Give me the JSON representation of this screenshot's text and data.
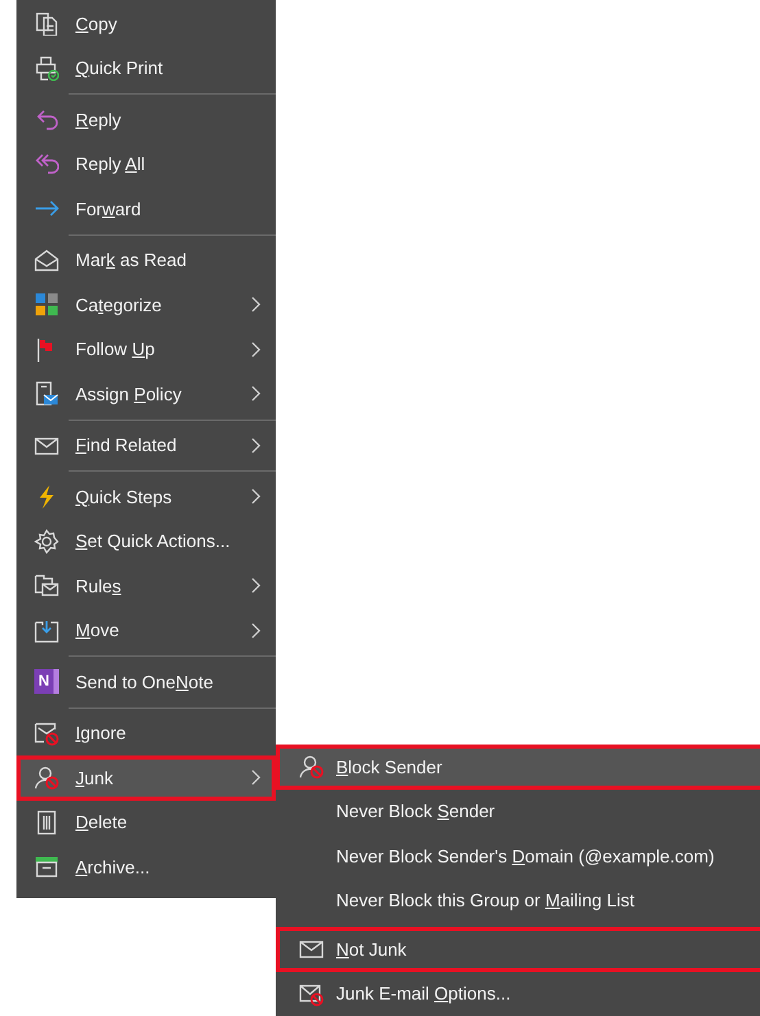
{
  "context_menu": {
    "items": [
      {
        "kind": "item",
        "label": {
          "key": "C",
          "after": "opy"
        },
        "has_submenu": false,
        "selected": false,
        "outlined": false
      },
      {
        "kind": "item",
        "label": {
          "key": "Q",
          "after": "uick Print"
        },
        "has_submenu": false,
        "selected": false,
        "outlined": false
      },
      {
        "kind": "separator"
      },
      {
        "kind": "item",
        "label": {
          "key": "R",
          "after": "eply"
        },
        "has_submenu": false,
        "selected": false,
        "outlined": false
      },
      {
        "kind": "item",
        "label": {
          "before": "Reply ",
          "key": "A",
          "after": "ll"
        },
        "has_submenu": false,
        "selected": false,
        "outlined": false
      },
      {
        "kind": "item",
        "label": {
          "before": "For",
          "key": "w",
          "after": "ard"
        },
        "has_submenu": false,
        "selected": false,
        "outlined": false
      },
      {
        "kind": "separator"
      },
      {
        "kind": "item",
        "label": {
          "before": "Mar",
          "key": "k",
          "after": " as Read"
        },
        "has_submenu": false,
        "selected": false,
        "outlined": false
      },
      {
        "kind": "item",
        "label": {
          "before": "Ca",
          "key": "t",
          "after": "egorize"
        },
        "has_submenu": true,
        "selected": false,
        "outlined": false
      },
      {
        "kind": "item",
        "label": {
          "before": "Follow ",
          "key": "U",
          "after": "p"
        },
        "has_submenu": true,
        "selected": false,
        "outlined": false
      },
      {
        "kind": "item",
        "label": {
          "before": "Assign ",
          "key": "P",
          "after": "olicy"
        },
        "has_submenu": true,
        "selected": false,
        "outlined": false
      },
      {
        "kind": "separator"
      },
      {
        "kind": "item",
        "label": {
          "key": "F",
          "after": "ind Related"
        },
        "has_submenu": true,
        "selected": false,
        "outlined": false
      },
      {
        "kind": "separator"
      },
      {
        "kind": "item",
        "label": {
          "key": "Q",
          "after": "uick Steps"
        },
        "has_submenu": true,
        "selected": false,
        "outlined": false
      },
      {
        "kind": "item",
        "label": {
          "key": "S",
          "after": "et Quick Actions..."
        },
        "has_submenu": false,
        "selected": false,
        "outlined": false
      },
      {
        "kind": "item",
        "label": {
          "before": "Rule",
          "key": "s"
        },
        "has_submenu": true,
        "selected": false,
        "outlined": false
      },
      {
        "kind": "item",
        "label": {
          "key": "M",
          "after": "ove"
        },
        "has_submenu": true,
        "selected": false,
        "outlined": false
      },
      {
        "kind": "separator"
      },
      {
        "kind": "item",
        "label": {
          "before": "Send to One",
          "key": "N",
          "after": "ote"
        },
        "icon_text": "N",
        "has_submenu": false,
        "selected": false,
        "outlined": false
      },
      {
        "kind": "separator"
      },
      {
        "kind": "item",
        "label": {
          "key": "I",
          "after": "gnore"
        },
        "has_submenu": false,
        "selected": false,
        "outlined": false
      },
      {
        "kind": "item",
        "label": {
          "key": "J",
          "after": "unk"
        },
        "has_submenu": true,
        "selected": true,
        "outlined": true
      },
      {
        "kind": "item",
        "label": {
          "key": "D",
          "after": "elete"
        },
        "has_submenu": false,
        "selected": false,
        "outlined": false
      },
      {
        "kind": "item",
        "label": {
          "key": "A",
          "after": "rchive..."
        },
        "has_submenu": false,
        "selected": false,
        "outlined": false
      }
    ]
  },
  "junk_submenu": {
    "items": [
      {
        "kind": "item",
        "label": {
          "key": "B",
          "after": "lock Sender"
        },
        "has_submenu": false,
        "selected": true,
        "outlined": true
      },
      {
        "kind": "item",
        "label": {
          "before": "Never Block ",
          "key": "S",
          "after": "ender"
        },
        "has_submenu": false,
        "selected": false,
        "outlined": false
      },
      {
        "kind": "item",
        "label": {
          "before": "Never Block Sender's ",
          "key": "D",
          "after": "omain (@example.com)"
        },
        "has_submenu": false,
        "selected": false,
        "outlined": false
      },
      {
        "kind": "item",
        "label": {
          "before": "Never Block this Group or ",
          "key": "M",
          "after": "ailing List"
        },
        "has_submenu": false,
        "selected": false,
        "outlined": false
      },
      {
        "kind": "gap"
      },
      {
        "kind": "item",
        "label": {
          "key": "N",
          "after": "ot Junk"
        },
        "has_submenu": false,
        "selected": false,
        "outlined": true
      },
      {
        "kind": "item",
        "label": {
          "before": "Junk E-mail ",
          "key": "O",
          "after": "ptions..."
        },
        "has_submenu": false,
        "selected": false,
        "outlined": false
      }
    ]
  }
}
